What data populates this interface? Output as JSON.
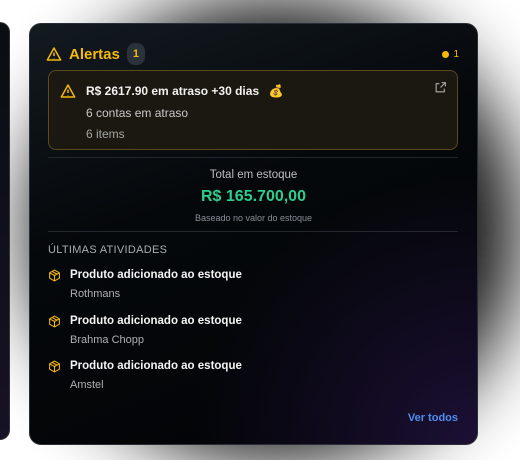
{
  "header": {
    "title": "Alertas",
    "count": "1",
    "indicator_count": "1"
  },
  "alert": {
    "title": "R$ 2617.90 em atraso +30 dias",
    "emoji": "💰",
    "line2": "6 contas em atraso",
    "line3": "6 items"
  },
  "stock": {
    "label": "Total em estoque",
    "value": "R$ 165.700,00",
    "note": "Baseado no valor do estoque"
  },
  "activities": {
    "heading": "ÚLTIMAS ATIVIDADES",
    "items": [
      {
        "title": "Produto adicionado ao estoque",
        "sub": "Rothmans"
      },
      {
        "title": "Produto adicionado ao estoque",
        "sub": "Brahma Chopp"
      },
      {
        "title": "Produto adicionado ao estoque",
        "sub": "Amstel"
      }
    ],
    "view_all": "Ver todos"
  },
  "colors": {
    "accent": "#f5b90b",
    "money": "#2ecc8f",
    "link": "#4f8ef0"
  }
}
